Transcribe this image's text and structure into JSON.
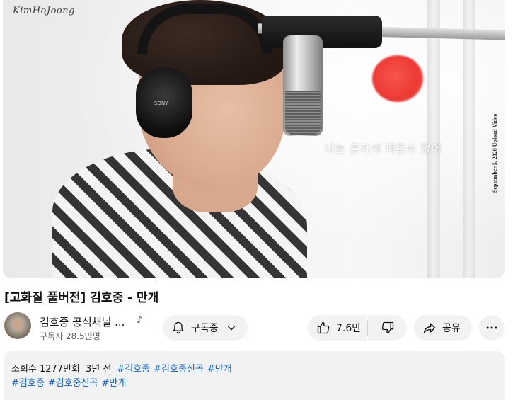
{
  "video": {
    "logo_text": "KimHoJoong",
    "headphone_brand": "SONY",
    "lyric_caption": "나는 혼자서 피울수 없어",
    "upload_note": "September 5. 2020 Upload Video"
  },
  "title": "[고화질 풀버전] 김호중 - 만개",
  "owner": {
    "channel_name": "김호중 공식채널 ...",
    "music_note_icon": "music-note-icon",
    "subscriber_count": "구독자 28.5만명"
  },
  "actions": {
    "subscribe_label": "구독중",
    "like_count": "7.6만",
    "share_label": "공유"
  },
  "description": {
    "view_count": "조회수 1277만회",
    "relative_date": "3년 전",
    "meta_hashtags": [
      "#김호중",
      "#김호중신곡",
      "#만개"
    ],
    "hashtags": [
      "#김호중",
      "#김호중신곡",
      "#만개"
    ]
  },
  "colors": {
    "link_blue": "#065fd4",
    "pill_bg": "#f2f2f2",
    "text_secondary": "#606060"
  }
}
